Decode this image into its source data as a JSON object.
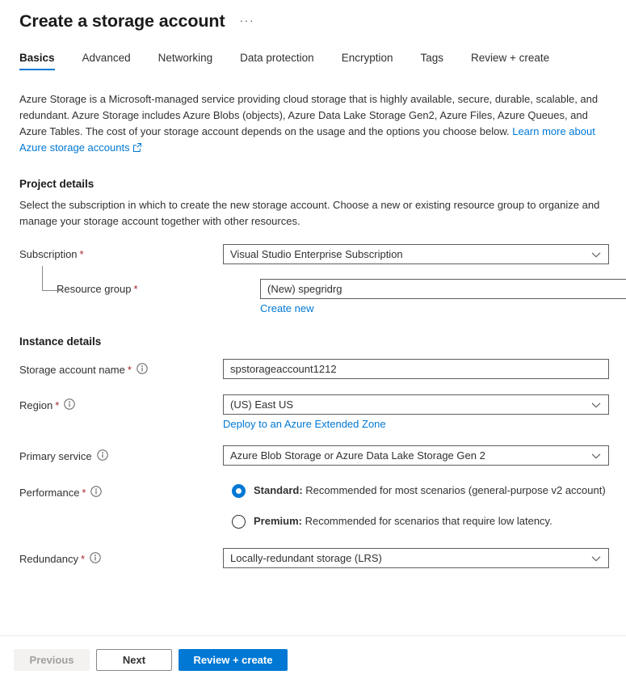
{
  "header": {
    "title": "Create a storage account",
    "ellipsis": "···"
  },
  "tabs": [
    {
      "label": "Basics",
      "active": true
    },
    {
      "label": "Advanced",
      "active": false
    },
    {
      "label": "Networking",
      "active": false
    },
    {
      "label": "Data protection",
      "active": false
    },
    {
      "label": "Encryption",
      "active": false
    },
    {
      "label": "Tags",
      "active": false
    },
    {
      "label": "Review + create",
      "active": false
    }
  ],
  "intro": {
    "text": "Azure Storage is a Microsoft-managed service providing cloud storage that is highly available, secure, durable, scalable, and redundant. Azure Storage includes Azure Blobs (objects), Azure Data Lake Storage Gen2, Azure Files, Azure Queues, and Azure Tables. The cost of your storage account depends on the usage and the options you choose below. ",
    "link_label": "Learn more about Azure storage accounts"
  },
  "project_details": {
    "title": "Project details",
    "description": "Select the subscription in which to create the new storage account. Choose a new or existing resource group to organize and manage your storage account together with other resources.",
    "subscription": {
      "label": "Subscription",
      "required": "*",
      "value": "Visual Studio Enterprise Subscription"
    },
    "resource_group": {
      "label": "Resource group",
      "required": "*",
      "value": "(New) spegridrg",
      "create_new_label": "Create new"
    }
  },
  "instance_details": {
    "title": "Instance details",
    "storage_account_name": {
      "label": "Storage account name",
      "required": "*",
      "value": "spstorageaccount1212",
      "info": "info-icon"
    },
    "region": {
      "label": "Region",
      "required": "*",
      "value": "(US) East US",
      "extended_zone_label": "Deploy to an Azure Extended Zone",
      "info": "info-icon"
    },
    "primary_service": {
      "label": "Primary service",
      "value": "Azure Blob Storage or Azure Data Lake Storage Gen 2",
      "info": "info-icon"
    },
    "performance": {
      "label": "Performance",
      "required": "*",
      "info": "info-icon",
      "options": [
        {
          "name": "Standard:",
          "description": " Recommended for most scenarios (general-purpose v2 account)",
          "selected": true
        },
        {
          "name": "Premium:",
          "description": " Recommended for scenarios that require low latency.",
          "selected": false
        }
      ]
    },
    "redundancy": {
      "label": "Redundancy",
      "required": "*",
      "value": "Locally-redundant storage (LRS)",
      "info": "info-icon"
    }
  },
  "footer": {
    "previous_label": "Previous",
    "next_label": "Next",
    "review_label": "Review + create"
  },
  "colors": {
    "accent": "#0078d4",
    "required": "#a4262c",
    "border": "#605e5c",
    "text": "#323130"
  }
}
